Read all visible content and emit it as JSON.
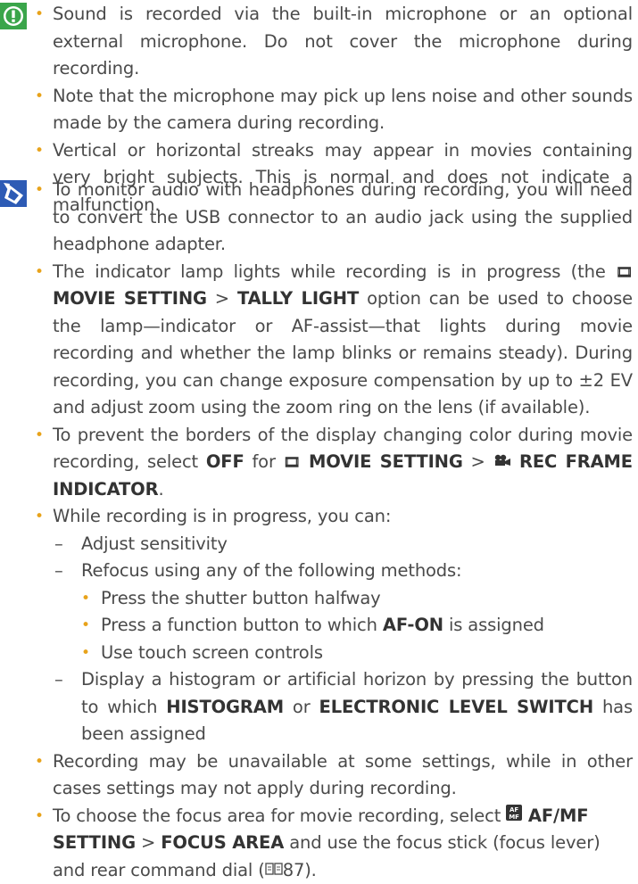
{
  "colors": {
    "text": "#4a4a4a",
    "bullet": "#e8a31b",
    "caution_icon": "#3aa54a",
    "note_icon": "#2d5bb5"
  },
  "icons": {
    "caution": "caution-icon",
    "note": "note-icon",
    "movie_menu": "movie-menu-icon",
    "movie_camera": "movie-camera-icon",
    "af_mf": "af-mf-icon",
    "page_ref": "book-reference-icon"
  },
  "bullet_char": "•",
  "dash_char": "–",
  "caution": {
    "b1": "Sound is recorded via the built-in microphone or an optional external microphone.  Do not cover the microphone during recording.",
    "b2": "Note that the microphone may pick up lens noise and other sounds made by the camera during recording.",
    "b3": "Vertical or horizontal streaks may appear in movies containing very bright subjects. This is normal and does not indicate a malfunction."
  },
  "notes": {
    "n1": "To monitor audio with headphones during recording, you will need to convert the USB connector to an audio jack using the supplied headphone adapter.",
    "n2": {
      "t1": "The indicator lamp lights while recording is in progress (the ",
      "icon": "🎞",
      "b1": " MOVIE SETTING",
      "t2": " > ",
      "b2": "TALLY LIGHT",
      "t3": " option can be used to choose the lamp—indicator or AF-assist—that lights during movie recording and whether the lamp blinks or remains steady). During recording, you can change exposure compensation by up to ±2 EV and adjust zoom using the zoom ring on the lens (if available)."
    },
    "n3": {
      "t1": "To prevent the borders of the display changing color during movie recording, select ",
      "b1": "OFF",
      "t2": " for ",
      "b2": " MOVIE SETTING",
      "t3": " > ",
      "b3": " REC FRAME INDICATOR",
      "t4": "."
    },
    "n4": {
      "intro": "While recording is in progress, you can:",
      "s1": "Adjust sensitivity",
      "s2": "Refocus using any of the following methods:",
      "ss1": "Press the shutter button halfway",
      "ss2_t1": "Press a function button to which ",
      "ss2_b": "AF-ON",
      "ss2_t2": " is assigned",
      "ss3": "Use touch screen controls",
      "s3_t1": "Display a histogram or artificial horizon by pressing the button to which ",
      "s3_b1": "HISTOGRAM",
      "s3_t2": " or ",
      "s3_b2": "ELECTRONIC LEVEL SWITCH",
      "s3_t3": " has been assigned"
    },
    "n5": "Recording may be unavailable at some settings, while in other cases settings may not apply during recording.",
    "n6": {
      "t1": "To choose the focus area for movie recording, select ",
      "b1": " AF/MF SETTING",
      "t2": " > ",
      "b2": "FOCUS AREA",
      "t3": " and use the focus stick (focus lever) and rear command dial (",
      "ref": "87",
      "t4": ")."
    }
  }
}
